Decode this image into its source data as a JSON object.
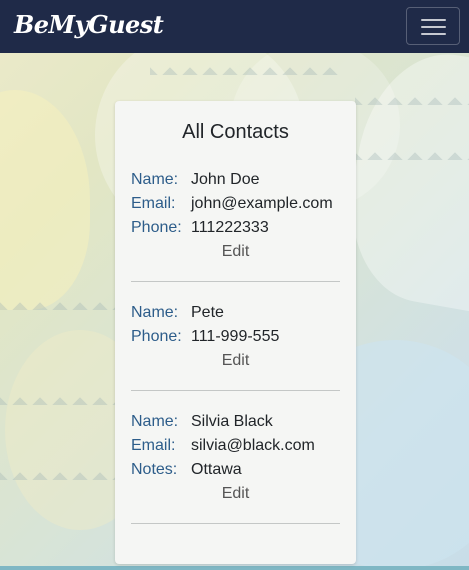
{
  "navbar": {
    "brand": "BeMyGuest",
    "toggler_icon": "hamburger-menu-icon",
    "background": "#1f2a48"
  },
  "card": {
    "title": "All Contacts",
    "contacts": [
      {
        "fields": [
          {
            "label": "Name:",
            "value": "John Doe"
          },
          {
            "label": "Email:",
            "value": "john@example.com"
          },
          {
            "label": "Phone:",
            "value": "111222333"
          }
        ],
        "edit_label": "Edit"
      },
      {
        "fields": [
          {
            "label": "Name:",
            "value": "Pete"
          },
          {
            "label": "Phone:",
            "value": "111-999-555"
          }
        ],
        "edit_label": "Edit"
      },
      {
        "fields": [
          {
            "label": "Name:",
            "value": "Silvia Black"
          },
          {
            "label": "Email:",
            "value": "silvia@black.com"
          },
          {
            "label": "Notes:",
            "value": "Ottawa"
          }
        ],
        "edit_label": "Edit"
      }
    ]
  },
  "colors": {
    "label": "#2d5d8a",
    "text": "#212529",
    "card_bg": "#f5f6f4"
  }
}
